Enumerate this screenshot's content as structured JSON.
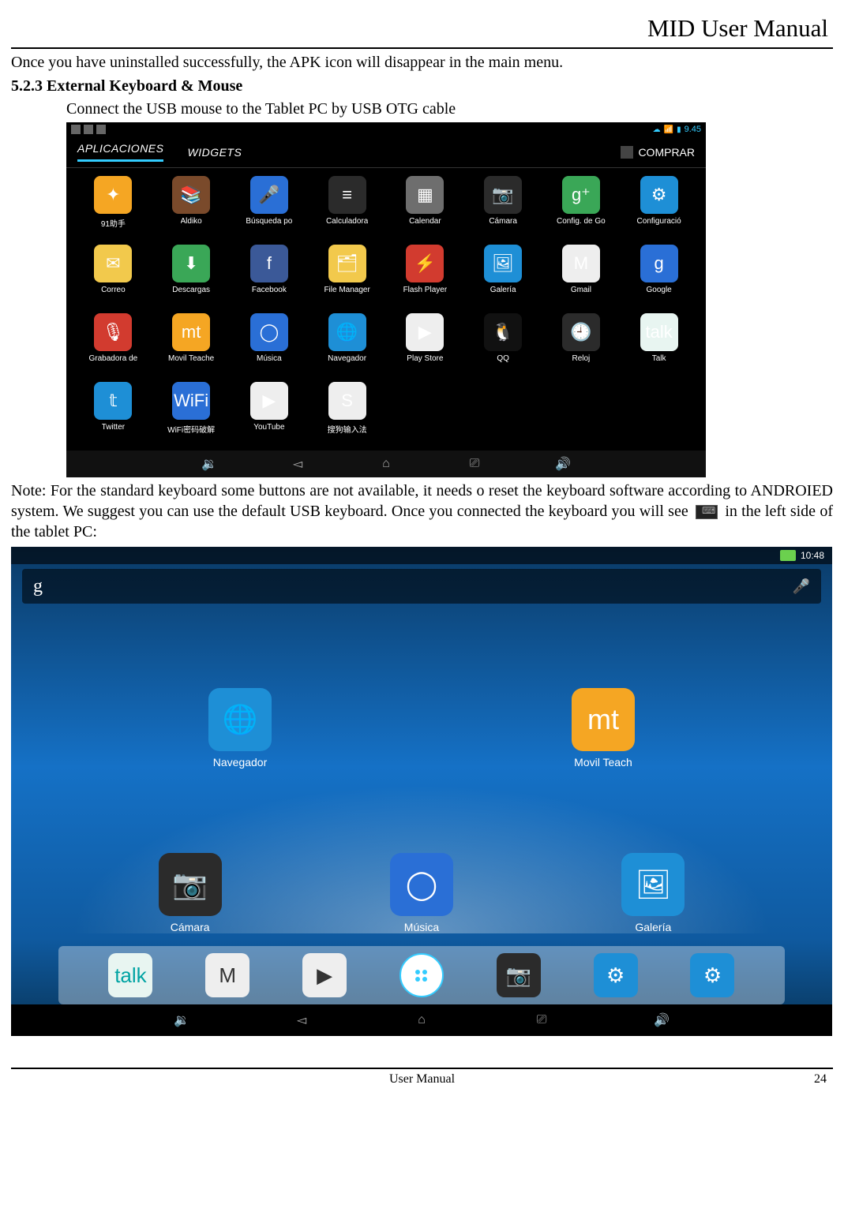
{
  "header": {
    "title": "MID User Manual"
  },
  "text": {
    "intro": "Once you have uninstalled successfully, the APK icon will disappear in the main menu.",
    "sec_heading": "5.2.3 External Keyboard & Mouse",
    "sec_line": "Connect the USB mouse to the Tablet PC by USB OTG cable",
    "note_pre": "Note: For the standard keyboard some buttons are not available, it needs o reset the keyboard software according to ANDROIED system. We suggest you can use the default USB keyboard. Once you connected the keyboard you will see ",
    "note_post": " in the left side of the tablet PC:"
  },
  "shot1": {
    "status_time": "9.45",
    "tabs": {
      "apps": "APLICACIONES",
      "widgets": "WIDGETS",
      "shop": "COMPRAR"
    },
    "apps": [
      {
        "label": "91助手",
        "glyph": "✦",
        "bg": "bg-orange"
      },
      {
        "label": "Aldiko",
        "glyph": "📚",
        "bg": "bg-brown"
      },
      {
        "label": "Búsqueda po",
        "glyph": "🎤",
        "bg": "bg-blue"
      },
      {
        "label": "Calculadora",
        "glyph": "≡",
        "bg": "bg-dark"
      },
      {
        "label": "Calendar",
        "glyph": "▦",
        "bg": "bg-grey"
      },
      {
        "label": "Cámara",
        "glyph": "📷",
        "bg": "bg-dark"
      },
      {
        "label": "Config. de Go",
        "glyph": "g⁺",
        "bg": "bg-green"
      },
      {
        "label": "Configuració",
        "glyph": "⚙",
        "bg": "bg-cyan"
      },
      {
        "label": "Correo",
        "glyph": "✉",
        "bg": "bg-yellow"
      },
      {
        "label": "Descargas",
        "glyph": "⬇",
        "bg": "bg-green"
      },
      {
        "label": "Facebook",
        "glyph": "f",
        "bg": "bg-fb"
      },
      {
        "label": "File Manager",
        "glyph": "🗂",
        "bg": "bg-yellow"
      },
      {
        "label": "Flash Player",
        "glyph": "⚡",
        "bg": "bg-red"
      },
      {
        "label": "Galería",
        "glyph": "🖼",
        "bg": "bg-cyan"
      },
      {
        "label": "Gmail",
        "glyph": "M",
        "bg": "bg-white"
      },
      {
        "label": "Google",
        "glyph": "g",
        "bg": "bg-blue"
      },
      {
        "label": "Grabadora de",
        "glyph": "🎙",
        "bg": "bg-red"
      },
      {
        "label": "Movil Teache",
        "glyph": "mt",
        "bg": "bg-orange"
      },
      {
        "label": "Música",
        "glyph": "◯",
        "bg": "bg-blue"
      },
      {
        "label": "Navegador",
        "glyph": "🌐",
        "bg": "bg-cyan"
      },
      {
        "label": "Play Store",
        "glyph": "▶",
        "bg": "bg-white"
      },
      {
        "label": "QQ",
        "glyph": "🐧",
        "bg": "bg-black"
      },
      {
        "label": "Reloj",
        "glyph": "🕘",
        "bg": "bg-dark"
      },
      {
        "label": "Talk",
        "glyph": "talk",
        "bg": "bg-talk"
      },
      {
        "label": "Twitter",
        "glyph": "𝕥",
        "bg": "bg-cyan"
      },
      {
        "label": "WiFi密码破解",
        "glyph": "WiFi",
        "bg": "bg-blue"
      },
      {
        "label": "YouTube",
        "glyph": "▶",
        "bg": "bg-white"
      },
      {
        "label": "搜狗输入法",
        "glyph": "S",
        "bg": "bg-white"
      }
    ]
  },
  "shot2": {
    "status_time": "10:48",
    "search_label": "g",
    "mid_apps": [
      {
        "label": "Navegador",
        "glyph": "🌐",
        "bg": "bg-cyan"
      },
      {
        "label": "Movil Teach",
        "glyph": "mt",
        "bg": "bg-orange"
      }
    ],
    "bot_apps": [
      {
        "label": "Cámara",
        "glyph": "📷",
        "bg": "bg-dark"
      },
      {
        "label": "Música",
        "glyph": "◯",
        "bg": "bg-blue"
      },
      {
        "label": "Galería",
        "glyph": "🖼",
        "bg": "bg-cyan"
      }
    ],
    "dock": [
      {
        "name": "talk",
        "glyph": "talk",
        "bg": "bg-talk"
      },
      {
        "name": "gmail",
        "glyph": "M",
        "bg": "bg-white"
      },
      {
        "name": "play",
        "glyph": "▶",
        "bg": "bg-white"
      },
      {
        "name": "apps",
        "glyph": "",
        "bg": ""
      },
      {
        "name": "camera",
        "glyph": "📷",
        "bg": "bg-dark"
      },
      {
        "name": "settings1",
        "glyph": "⚙",
        "bg": "bg-cyan"
      },
      {
        "name": "settings2",
        "glyph": "⚙",
        "bg": "bg-cyan"
      }
    ]
  },
  "footer": {
    "text": "User Manual",
    "page": "24"
  }
}
